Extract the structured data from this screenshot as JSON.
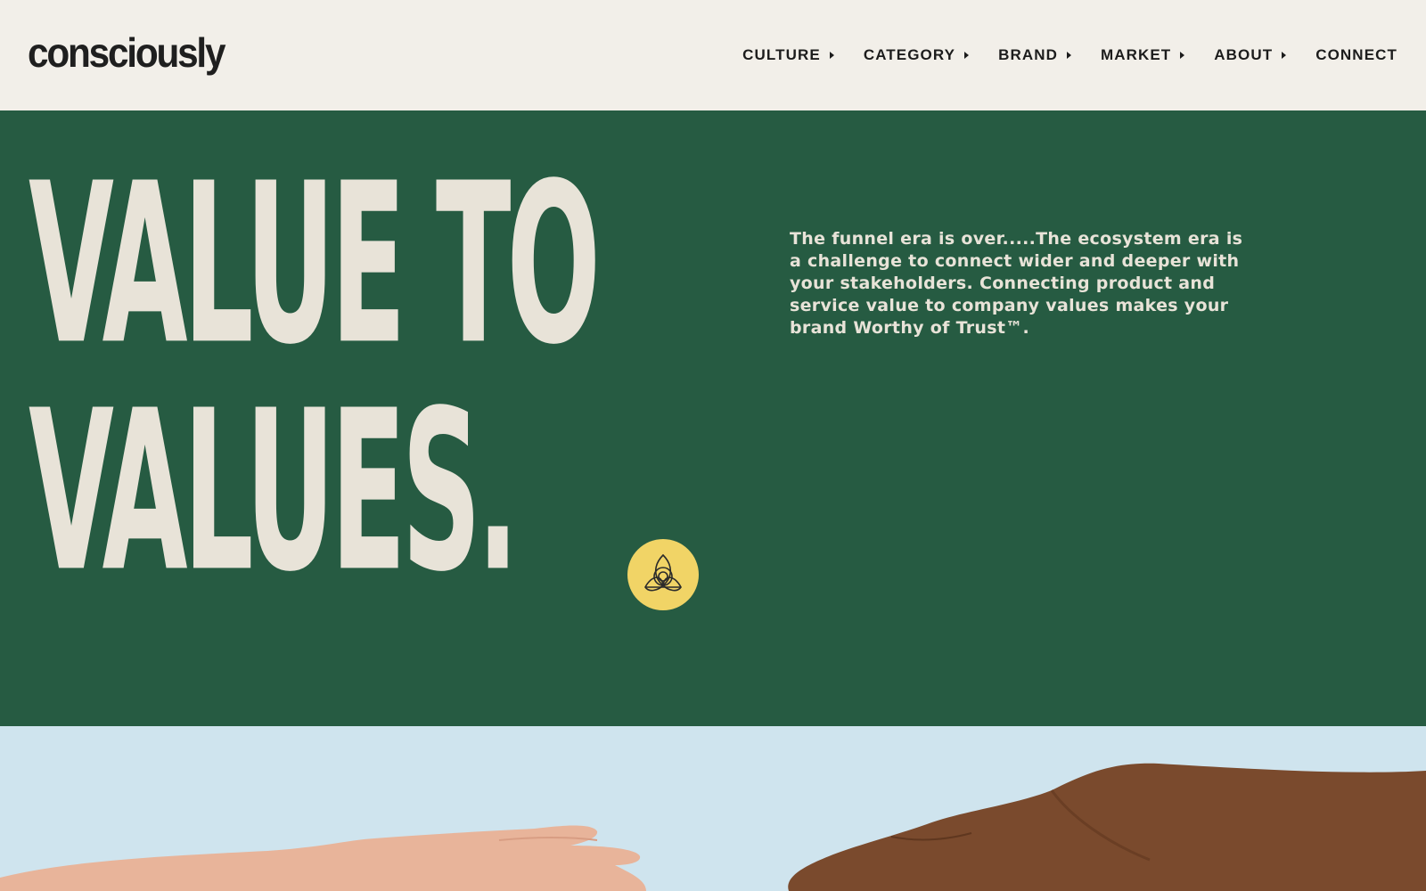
{
  "header": {
    "logo": "consciously",
    "nav": [
      {
        "label": "CULTURE",
        "has_caret": true
      },
      {
        "label": "CATEGORY",
        "has_caret": true
      },
      {
        "label": "BRAND",
        "has_caret": true
      },
      {
        "label": "MARKET",
        "has_caret": true
      },
      {
        "label": "ABOUT",
        "has_caret": true
      },
      {
        "label": "CONNECT",
        "has_caret": false
      }
    ]
  },
  "hero": {
    "headline_line1": "VALUE TO",
    "headline_line2": "VALUES.",
    "body": "The funnel era is over.....The ecosystem era is a challenge to connect wider and deeper with your stakeholders. Connecting product and service value to company values makes your brand Worthy of Trust™.",
    "badge_icon": "triquetra-circle-icon"
  },
  "photo": {
    "description_icon": "reaching-hands-image"
  },
  "colors": {
    "background_light": "#f2efe9",
    "hero_green": "#265b42",
    "headline_cream": "#e8e3d8",
    "badge_yellow": "#f1d466",
    "sky_blue": "#cfe4ee",
    "text_dark": "#1c1c1c"
  }
}
